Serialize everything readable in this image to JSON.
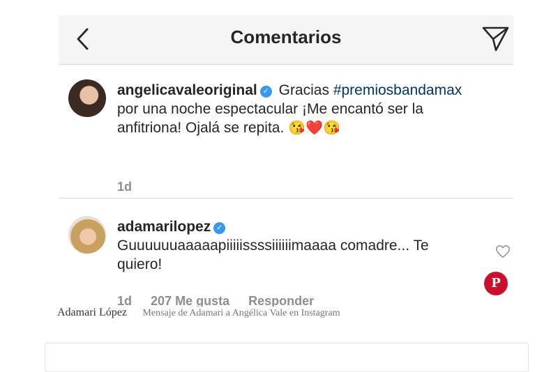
{
  "header": {
    "title": "Comentarios",
    "back_icon": "chevron-left-icon",
    "send_icon": "paper-plane-icon"
  },
  "comments": [
    {
      "username": "angelicavaleoriginal",
      "verified": true,
      "text_before": "Gracias",
      "hashtag": "#premiosbandamax",
      "text_after": "por una noche espectacular ¡Me encantó ser la anfitriona! Ojalá se repita.",
      "emojis": "😘❤️😘",
      "time": "1d"
    },
    {
      "username": "adamarilopez",
      "verified": true,
      "text": "Guuuuuuaaaaapiiiiissssiiiiiimaaaa comadre... Te quiero!",
      "time": "1d",
      "likes": "207 Me gusta",
      "reply": "Responder"
    }
  ],
  "pin_label": "P",
  "caption": {
    "credit": "Adamari López",
    "description": "Mensaje de Adamari a Angélica Vale en Instagram"
  },
  "colors": {
    "link": "#003569",
    "verified": "#3897f0",
    "pinterest": "#c8102e"
  }
}
